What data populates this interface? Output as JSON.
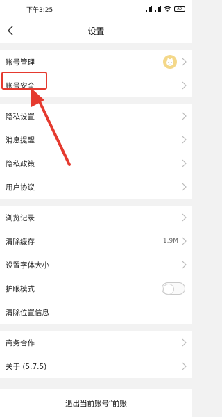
{
  "status_bar": {
    "time": "下午3:25",
    "battery": "82"
  },
  "header": {
    "title": "设置"
  },
  "groups": [
    {
      "items": [
        {
          "label": "账号管理"
        },
        {
          "label": "账号安全"
        }
      ]
    },
    {
      "items": [
        {
          "label": "隐私设置"
        },
        {
          "label": "消息提醒"
        },
        {
          "label": "隐私政策"
        },
        {
          "label": "用户协议"
        }
      ]
    },
    {
      "items": [
        {
          "label": "浏览记录"
        },
        {
          "label": "清除缓存",
          "value": "1.9M"
        },
        {
          "label": "设置字体大小"
        },
        {
          "label": "护眼模式",
          "toggle": false
        },
        {
          "label": "清除位置信息"
        }
      ]
    },
    {
      "items": [
        {
          "label": "商务合作"
        },
        {
          "label": "关于 (5.7.5)"
        }
      ]
    }
  ],
  "footer": {
    "logout_label": "退出当前账号′′前账"
  },
  "colors": {
    "highlight": "#e53a2f",
    "background": "#f2f2f2"
  }
}
